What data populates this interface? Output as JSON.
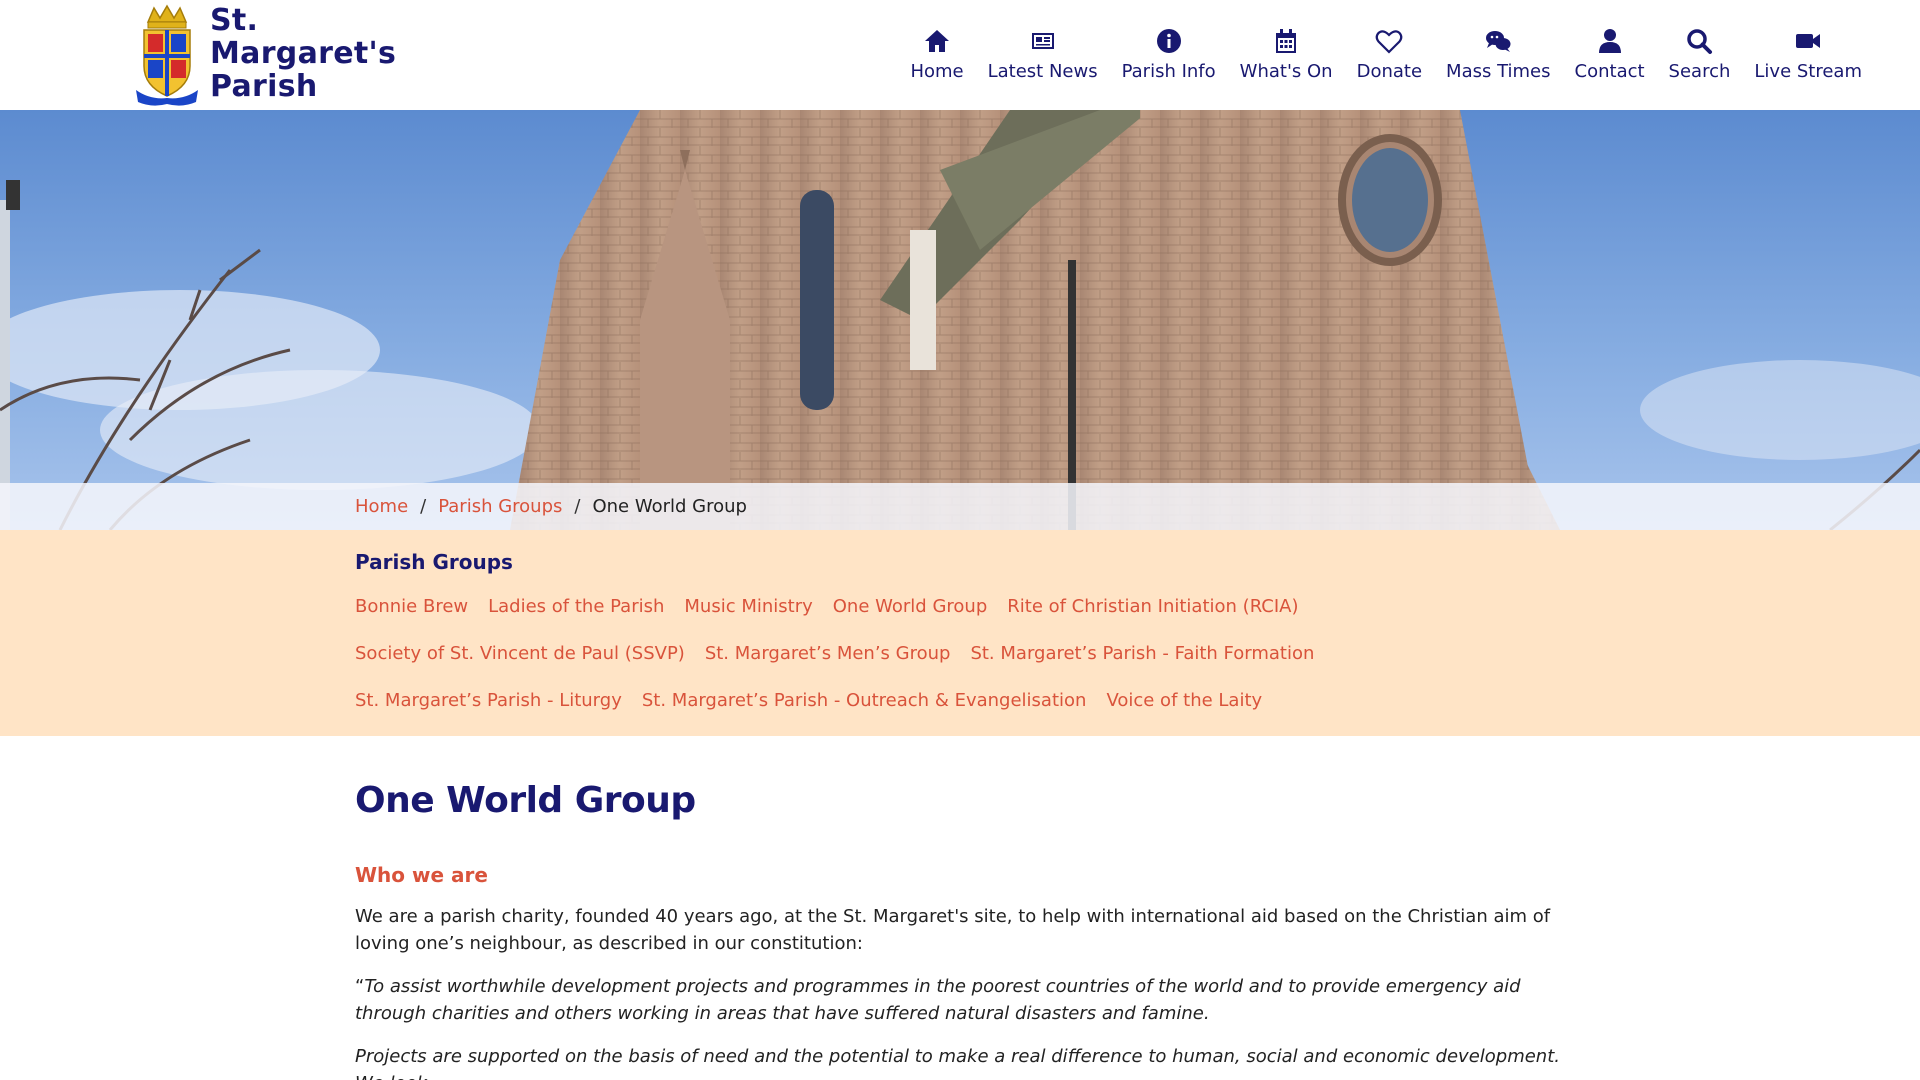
{
  "site": {
    "logo_lines": [
      "St.",
      "Margaret's",
      "Parish"
    ]
  },
  "nav": [
    {
      "label": "Home",
      "icon": "home-icon"
    },
    {
      "label": "Latest News",
      "icon": "newspaper-icon"
    },
    {
      "label": "Parish Info",
      "icon": "info-icon"
    },
    {
      "label": "What's On",
      "icon": "calendar-icon"
    },
    {
      "label": "Donate",
      "icon": "heart-icon"
    },
    {
      "label": "Mass Times",
      "icon": "chat-icon"
    },
    {
      "label": "Contact",
      "icon": "user-icon"
    },
    {
      "label": "Search",
      "icon": "search-icon"
    },
    {
      "label": "Live Stream",
      "icon": "video-icon"
    }
  ],
  "breadcrumb": {
    "home": "Home",
    "parent": "Parish Groups",
    "current": "One World Group",
    "separator": "/"
  },
  "groups": {
    "title": "Parish Groups",
    "items": [
      "Bonnie Brew",
      "Ladies of the Parish",
      "Music Ministry",
      "One World Group",
      "Rite of Christian Initiation (RCIA)",
      "Society of St. Vincent de Paul (SSVP)",
      "St. Margaret’s Men’s Group",
      "St. Margaret’s Parish - Faith Formation",
      "St. Margaret’s Parish - Liturgy",
      "St. Margaret’s Parish - Outreach & Evangelisation",
      "Voice of the Laity"
    ]
  },
  "main": {
    "title": "One World Group",
    "subheading": "Who we are",
    "paragraph": "We are a parish charity, founded 40 years ago, at the St. Margaret's site, to help with international aid based on the Christian aim of loving one’s neighbour, as described in our constitution:",
    "quote_open": "“",
    "quote": "To assist worthwhile development projects and programmes in the poorest countries of the world and to provide emergency aid through charities and others working in areas that have suffered natural disasters and famine.",
    "quote2": "Projects are supported on the basis of need and the potential to make a real difference to human, social and economic development. We look"
  },
  "colors": {
    "navy": "#191970",
    "accent": "#d9533b",
    "groups_bg": "#ffe4c6"
  }
}
